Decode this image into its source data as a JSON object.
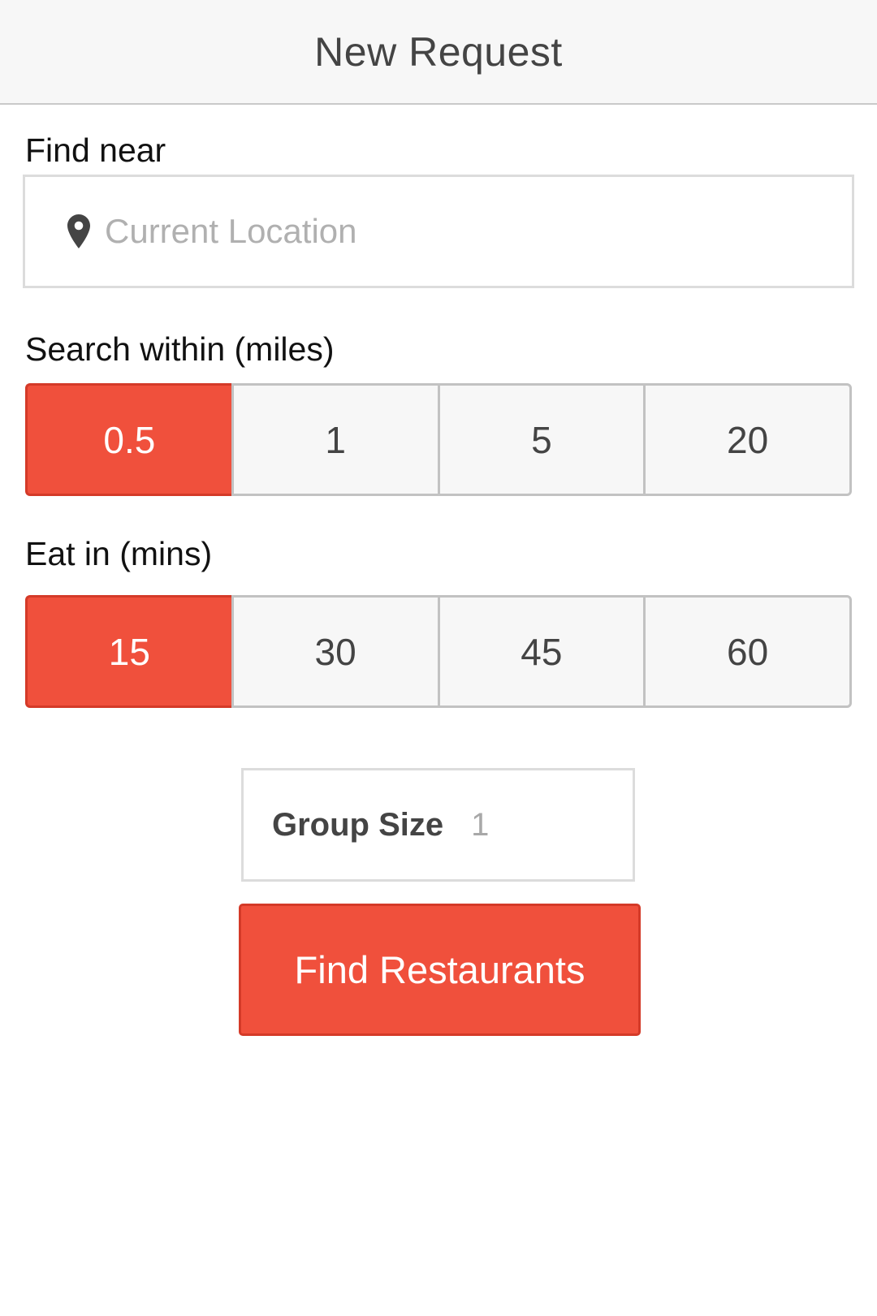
{
  "header": {
    "title": "New Request"
  },
  "find_near": {
    "label": "Find near",
    "placeholder": "Current Location",
    "value": "",
    "icon": "map-pin-icon"
  },
  "search_within": {
    "label": "Search within (miles)",
    "options": [
      "0.5",
      "1",
      "5",
      "20"
    ],
    "selected": "0.5"
  },
  "eat_in": {
    "label": "Eat in (mins)",
    "options": [
      "15",
      "30",
      "45",
      "60"
    ],
    "selected": "15"
  },
  "group_size": {
    "label": "Group Size",
    "value": "1"
  },
  "find_button": {
    "label": "Find Restaurants"
  },
  "colors": {
    "accent": "#f0503c",
    "accent_border": "#d43a28",
    "header_bg": "#f7f7f7",
    "segment_bg": "#f7f7f7"
  }
}
